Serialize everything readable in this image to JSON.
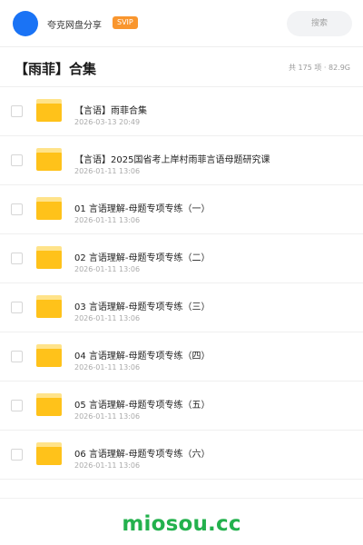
{
  "header": {
    "app_name": "夸克网盘分享",
    "badge": "SVIP",
    "search_placeholder": "搜索",
    "avatar_color": "#1a73f5"
  },
  "title_row": {
    "title": "【雨菲】合集",
    "summary": "共 175 项 · 82.9G"
  },
  "files": [
    {
      "name": "【言语】雨菲合集",
      "date": "2026-03-13 20:49",
      "icon": "folder-icon"
    },
    {
      "name": "【言语】2025国省考上岸村雨菲言语母题研究课",
      "date": "2026-01-11 13:06",
      "icon": "folder-icon"
    },
    {
      "name": "01 言语理解-母题专项专练（一）",
      "date": "2026-01-11 13:06",
      "icon": "folder-icon"
    },
    {
      "name": "02 言语理解-母题专项专练（二）",
      "date": "2026-01-11 13:06",
      "icon": "folder-icon"
    },
    {
      "name": "03 言语理解-母题专项专练（三）",
      "date": "2026-01-11 13:06",
      "icon": "folder-icon"
    },
    {
      "name": "04 言语理解-母题专项专练（四）",
      "date": "2026-01-11 13:06",
      "icon": "folder-icon"
    },
    {
      "name": "05 言语理解-母题专项专练（五）",
      "date": "2026-01-11 13:06",
      "icon": "folder-icon"
    },
    {
      "name": "06 言语理解-母题专项专练（六）",
      "date": "2026-01-11 13:06",
      "icon": "folder-icon"
    }
  ],
  "footer": {
    "brand": "miosou.cc",
    "brand_color": "#23b14d"
  },
  "colors": {
    "badge": "#f9962e",
    "folder": "#ffc21a"
  }
}
